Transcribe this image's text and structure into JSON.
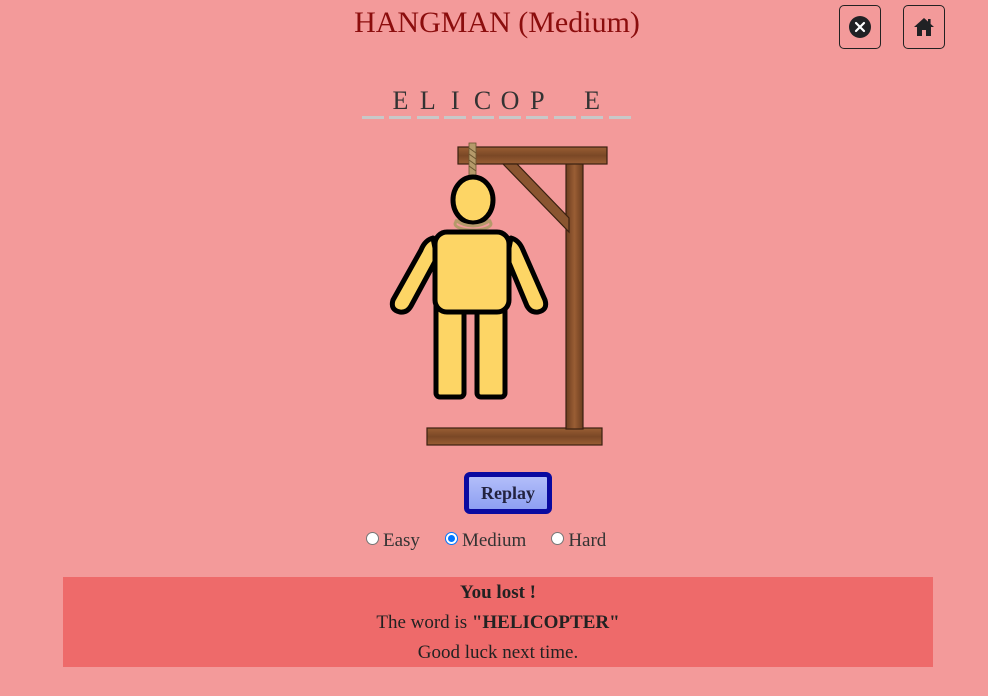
{
  "header": {
    "title": "HANGMAN (Medium)",
    "close_icon": "close-circle-icon",
    "home_icon": "home-icon"
  },
  "word": {
    "slots": [
      "",
      "E",
      "L",
      "I",
      "C",
      "O",
      "P",
      "",
      "E",
      ""
    ]
  },
  "controls": {
    "replay_label": "Replay",
    "difficulty": {
      "options": [
        {
          "label": "Easy",
          "checked": false
        },
        {
          "label": "Medium",
          "checked": true
        },
        {
          "label": "Hard",
          "checked": false
        }
      ]
    }
  },
  "result": {
    "status": "You lost !",
    "word_prefix": "The word is",
    "word": "\"HELICOPTER\"",
    "message": "Good luck next time."
  },
  "colors": {
    "background": "#f39a9a",
    "title": "#8b0d0d",
    "result_bg": "#ee6a6a",
    "replay_border": "#0a0aa0",
    "figure_fill": "#fdd565"
  }
}
